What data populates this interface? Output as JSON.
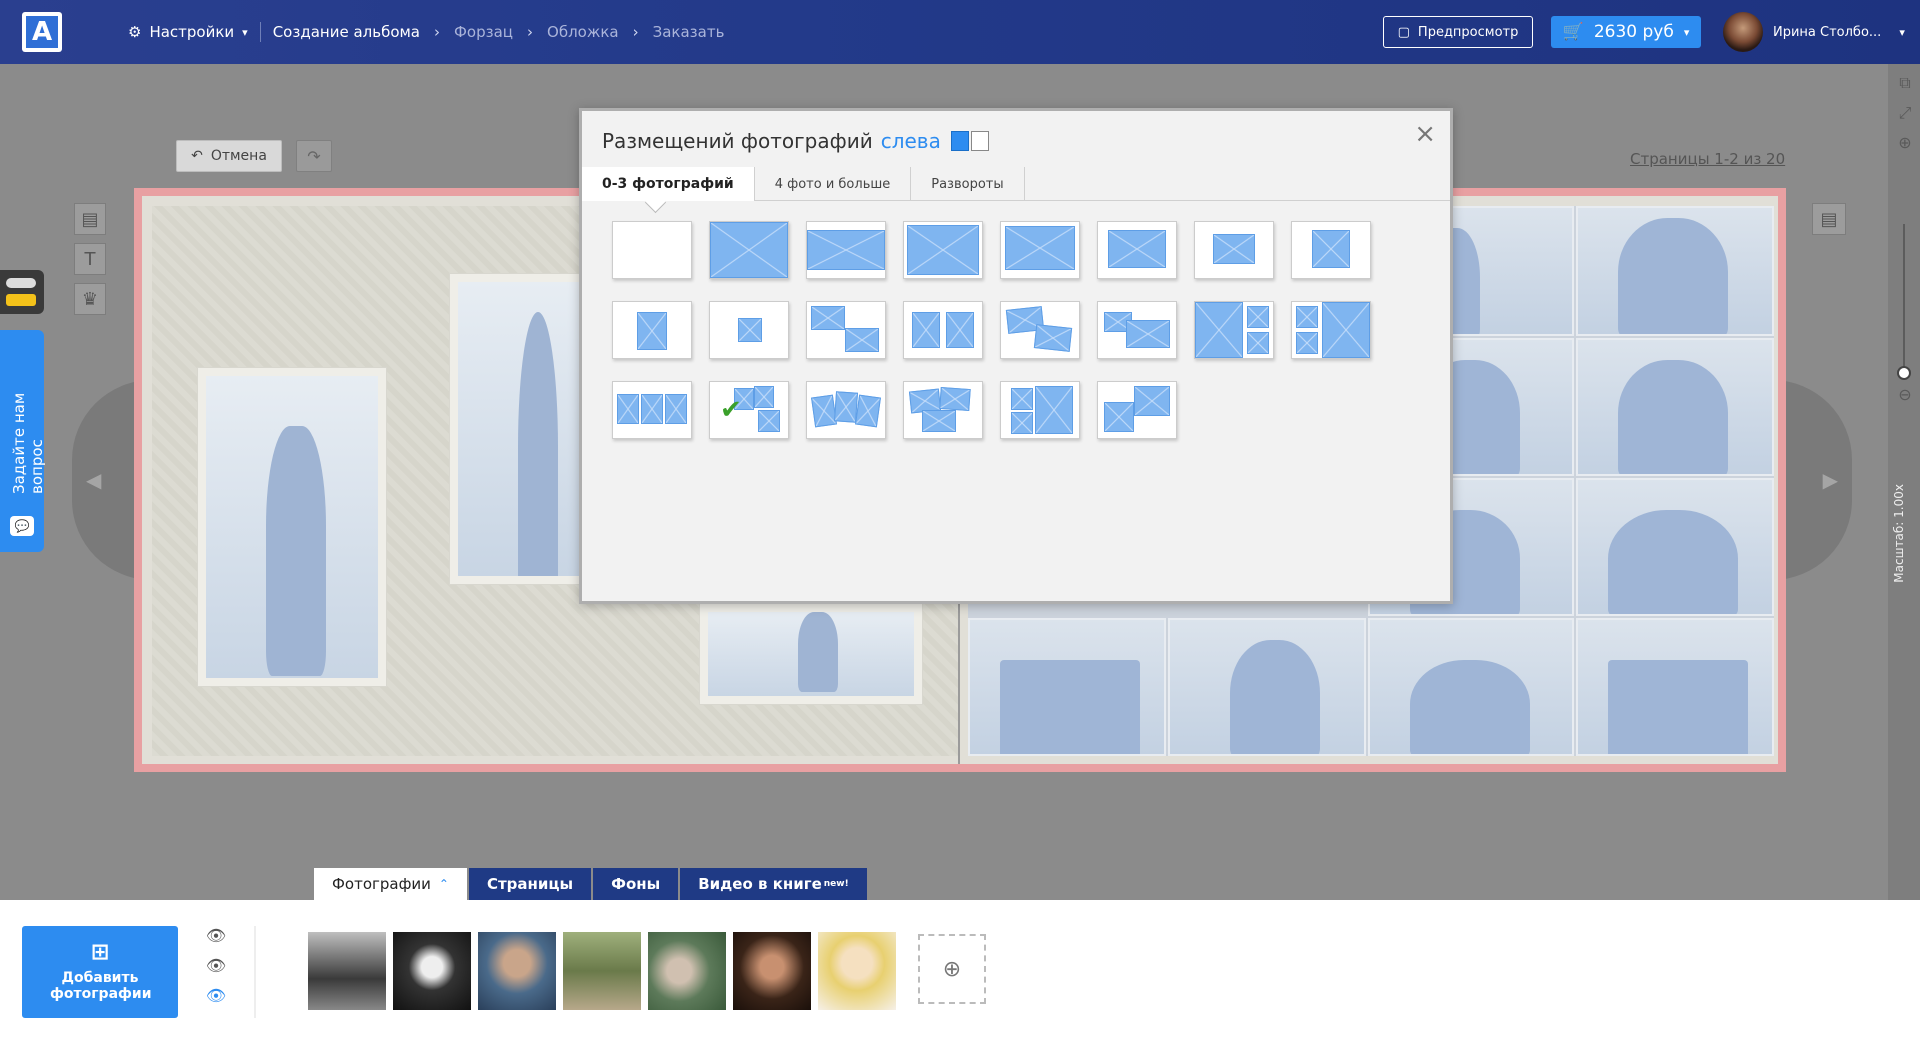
{
  "header": {
    "logo": "A",
    "settings_label": "Настройки",
    "breadcrumbs": [
      {
        "label": "Создание альбома",
        "active": true
      },
      {
        "label": "Форзац",
        "active": false
      },
      {
        "label": "Обложка",
        "active": false
      },
      {
        "label": "Заказать",
        "active": false
      }
    ],
    "preview_label": "Предпросмотр",
    "cart_label": "2630 руб",
    "user_name": "Ирина Столбо..."
  },
  "editor": {
    "undo_label": "Отмена",
    "pages_count": "Страницы 1-2 из 20",
    "help_label": "Задайте нам вопрос",
    "zoom_label": "Масштаб: 1.00x"
  },
  "modal": {
    "title_prefix": "Размещений фотографий",
    "title_accent": "слева",
    "close": "×",
    "tabs": [
      {
        "label": "0-3 фотографий",
        "active": true
      },
      {
        "label": "4 фото и больше",
        "active": false
      },
      {
        "label": "Развороты",
        "active": false
      }
    ]
  },
  "bottom": {
    "tabs": [
      {
        "label": "Фотографии",
        "active": true,
        "sup": ""
      },
      {
        "label": "Страницы",
        "active": false,
        "sup": ""
      },
      {
        "label": "Фоны",
        "active": false,
        "sup": ""
      },
      {
        "label": "Видео в книге",
        "active": false,
        "sup": "new!"
      }
    ],
    "tab_chevron": "⌃",
    "add_photos_label": "Добавить фотографии"
  },
  "colors": {
    "brand_blue": "#2d8cf0",
    "topbar": "#2a3f8f",
    "spread_border": "#e8a0a2"
  }
}
